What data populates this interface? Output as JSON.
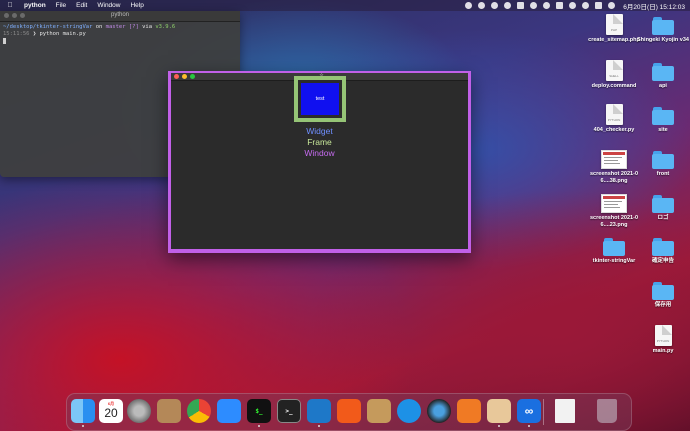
{
  "menubar": {
    "app_name": "python",
    "menus": [
      "File",
      "Edit",
      "Window",
      "Help"
    ],
    "clock": "6月20日(日) 15:12:03"
  },
  "terminal": {
    "title": "python",
    "prompt_path": "~/desktop/tkinter-stringVar",
    "prompt_on": "on",
    "git_branch": "master",
    "git_status": "[?]",
    "prompt_via": "via",
    "python_version": "v3.9.6",
    "time": "15:11:56",
    "command": "python main.py"
  },
  "tk_window": {
    "button_label": "test",
    "label_widget": "Widget",
    "label_frame": "Frame",
    "label_window": "Window",
    "colors": {
      "window_bg": "#c160e8",
      "frame_bg": "#95c476",
      "button_bg": "#1010f0",
      "widget_text": "#6f8fff",
      "frame_text": "#c8e89a",
      "window_text": "#c66bf0"
    }
  },
  "desktop_icons": [
    {
      "label": "create_sitemap.php",
      "type": "file",
      "ext": "PHP"
    },
    {
      "label": "Shingeki Kyojin v34",
      "type": "folder"
    },
    {
      "label": "deploy.command",
      "type": "file",
      "ext": "SHELL"
    },
    {
      "label": "api",
      "type": "folder"
    },
    {
      "label": "404_checker.py",
      "type": "file",
      "ext": "PYTHON"
    },
    {
      "label": "site",
      "type": "folder"
    },
    {
      "label": "screenshot 2021-06....38.png",
      "type": "image"
    },
    {
      "label": "front",
      "type": "folder"
    },
    {
      "label": "screenshot 2021-06....23.png",
      "type": "image"
    },
    {
      "label": "ロゴ",
      "type": "folder"
    },
    {
      "label": "tkinter-stringVar",
      "type": "folder"
    },
    {
      "label": "確定申告",
      "type": "folder"
    },
    {
      "label": "保存用",
      "type": "folder"
    },
    {
      "label": "main.py",
      "type": "file",
      "ext": "PYTHON"
    }
  ],
  "dock": {
    "calendar_month": "6月",
    "calendar_day": "20",
    "apps": [
      "finder-icon",
      "calendar-icon",
      "system-preferences-icon",
      "contacts-icon",
      "chrome-icon",
      "zoom-icon",
      "terminal-icon",
      "terminal-alt-icon",
      "vscode-icon",
      "activity-icon",
      "archive-icon",
      "docker-icon",
      "quicktime-icon",
      "sourcetree-icon",
      "preview-icon",
      "infinity-icon",
      "document-icon",
      "trash-icon"
    ]
  }
}
